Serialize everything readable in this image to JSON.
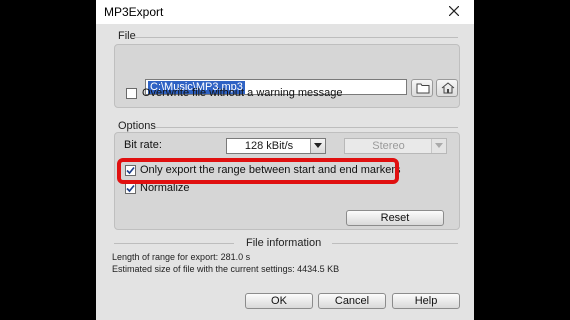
{
  "window": {
    "title": "MP3Export"
  },
  "file_section": {
    "label": "File",
    "path_value": "C:\\Music\\MP3.mp3",
    "overwrite_label": "Overwrite file without a warning message",
    "overwrite_checked": false
  },
  "options_section": {
    "label": "Options",
    "bitrate_label": "Bit rate:",
    "bitrate_value": "128 kBit/s",
    "channel_value": "Stereo",
    "export_range_label": "Only export the range between start and end markers",
    "export_range_checked": true,
    "normalize_label": "Normalize",
    "normalize_checked": true,
    "reset_label": "Reset"
  },
  "file_info": {
    "label": "File information",
    "length_text": "Length of range for export: 281.0 s",
    "size_text": "Estimated size of file with the current settings: 4434.5 KB"
  },
  "buttons": {
    "ok": "OK",
    "cancel": "Cancel",
    "help": "Help"
  },
  "colors": {
    "highlight": "#e01010",
    "selection": "#2f62c4"
  }
}
